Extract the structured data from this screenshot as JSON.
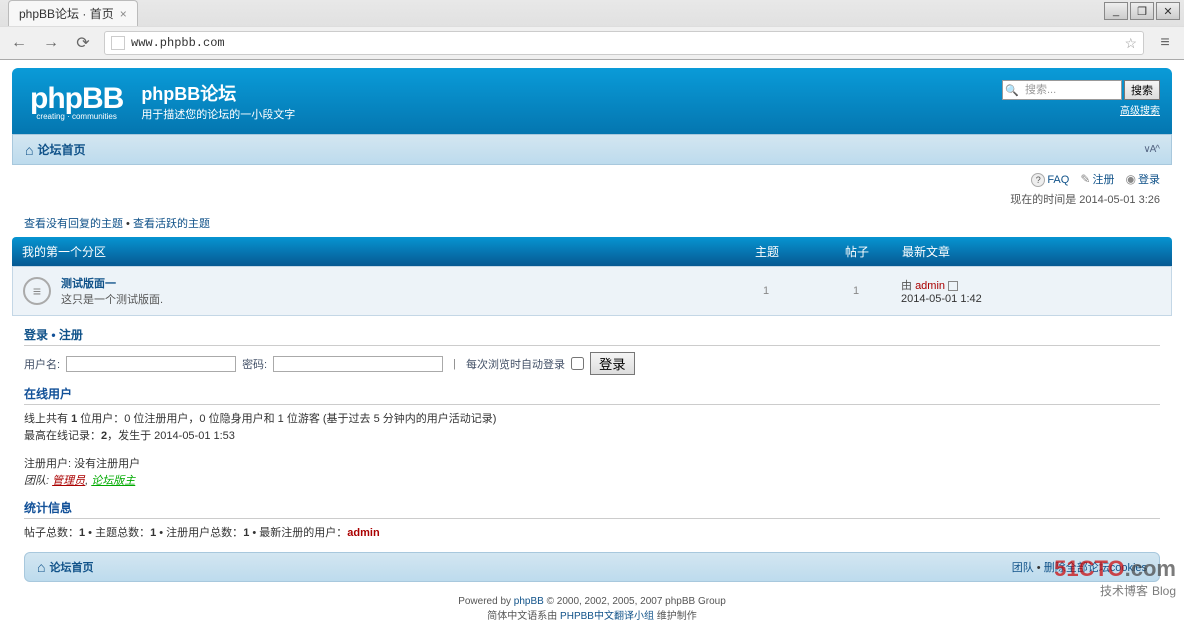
{
  "browser": {
    "tab_title": "phpBB论坛 · 首页",
    "url": "www.phpbb.com",
    "back": "←",
    "forward": "→",
    "reload": "⟳",
    "star": "☆",
    "menu": "≡",
    "win_min": "_",
    "win_max": "❐",
    "win_close": "✕",
    "tab_close": "×"
  },
  "site": {
    "logo": "phpBB",
    "logo_sub": "creating · communities",
    "title": "phpBB论坛",
    "desc": "用于描述您的论坛的一小段文字"
  },
  "search": {
    "placeholder": "搜索...",
    "button": "搜索",
    "advanced": "高级搜索"
  },
  "nav": {
    "index": "论坛首页",
    "font": "∨A^",
    "faq": "FAQ",
    "register": "注册",
    "login": "登录",
    "time": "现在的时间是 2014-05-01 3:26"
  },
  "quick": {
    "unanswered": "查看没有回复的主题",
    "sep": " • ",
    "active": "查看活跃的主题"
  },
  "forum": {
    "category": "我的第一个分区",
    "col_topics": "主题",
    "col_posts": "帖子",
    "col_last": "最新文章",
    "name": "测试版面一",
    "desc": "这只是一个测试版面.",
    "topics": "1",
    "posts": "1",
    "last_by": "由 ",
    "last_user": "admin",
    "last_date": "2014-05-01 1:42"
  },
  "login": {
    "heading_login": "登录",
    "heading_sep": " • ",
    "heading_register": "注册",
    "username": "用户名:",
    "password": "密码:",
    "autologin": "每次浏览时自动登录",
    "submit": "登录"
  },
  "online": {
    "heading": "在线用户",
    "line1_a": "线上共有 ",
    "line1_b": "1",
    "line1_c": " 位用户：0 位注册用户，0 位隐身用户和 1 位游客 (基于过去 5 分钟内的用户活动记录)",
    "line2_a": "最高在线记录：",
    "line2_b": "2",
    "line2_c": "，发生于 2014-05-01 1:53",
    "line3": "注册用户: 没有注册用户",
    "legend_label": "团队: ",
    "legend_admin": "管理员",
    "legend_sep": ", ",
    "legend_mod": "论坛版主"
  },
  "stats": {
    "heading": "统计信息",
    "posts_label": "帖子总数：",
    "posts": "1",
    "topics_label": " • 主题总数：",
    "topics": "1",
    "users_label": " • 注册用户总数：",
    "users": "1",
    "newest_label": " • 最新注册的用户：",
    "newest_user": "admin"
  },
  "footer": {
    "team": "团队",
    "sep": " • ",
    "delete_cookies": "删除全部论坛cookies",
    "powered_a": "Powered by ",
    "powered_b": "phpBB",
    "powered_c": " © 2000, 2002, 2005, 2007 phpBB Group",
    "trans_a": "简体中文语系由 ",
    "trans_b": "PHPBB中文翻译小组",
    "trans_c": " 维护制作"
  },
  "watermark": {
    "a": "51CTO",
    "b": ".com",
    "c": "技术博客",
    "d": "Blog"
  }
}
